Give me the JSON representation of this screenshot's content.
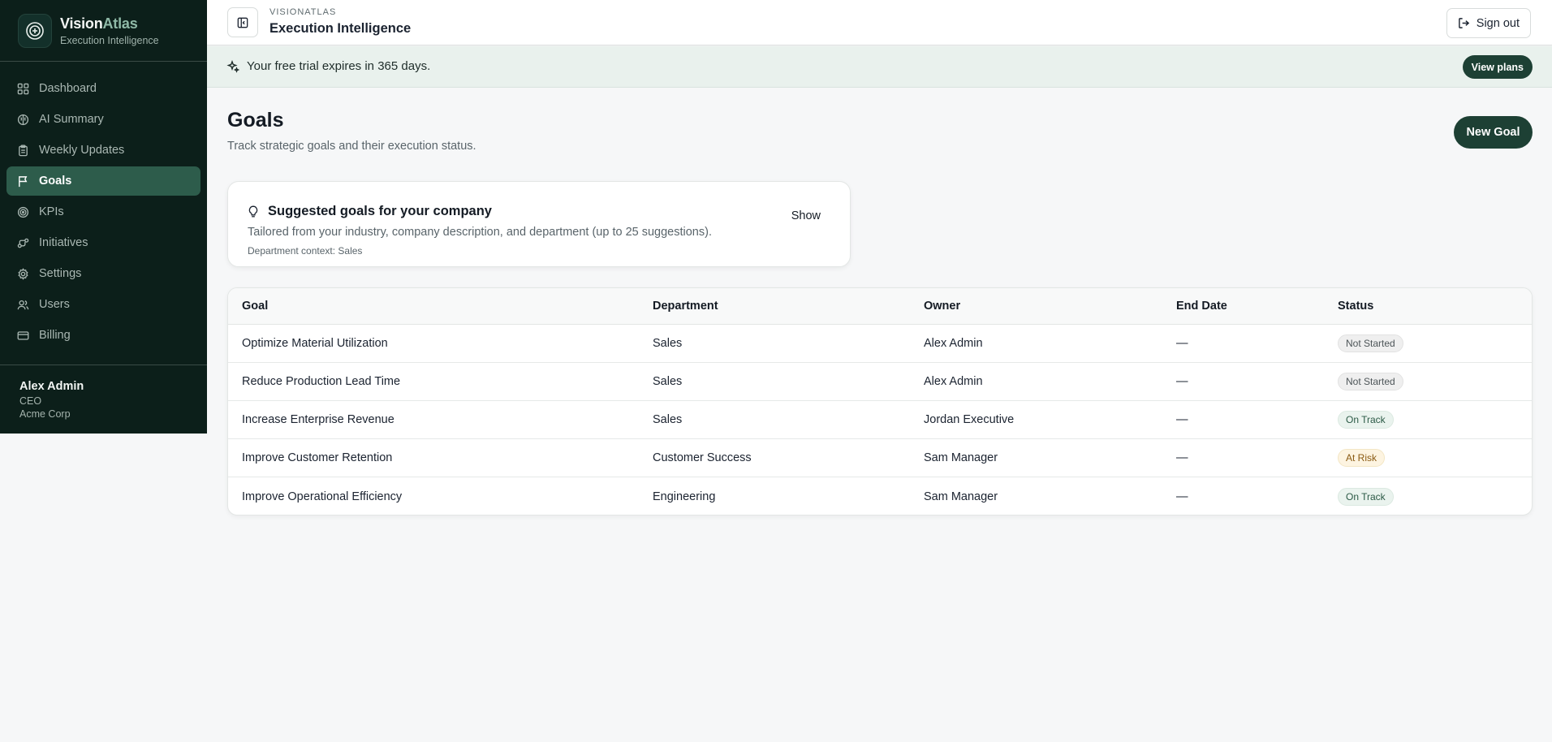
{
  "brand": {
    "name_main": "Vision",
    "name_accent": "Atlas",
    "subtitle": "Execution Intelligence"
  },
  "sidebar": {
    "items": [
      {
        "label": "Dashboard",
        "icon": "grid-icon",
        "active": false
      },
      {
        "label": "AI Summary",
        "icon": "brain-icon",
        "active": false
      },
      {
        "label": "Weekly Updates",
        "icon": "clipboard-icon",
        "active": false
      },
      {
        "label": "Goals",
        "icon": "flag-icon",
        "active": true
      },
      {
        "label": "KPIs",
        "icon": "target-icon",
        "active": false
      },
      {
        "label": "Initiatives",
        "icon": "workflow-icon",
        "active": false
      },
      {
        "label": "Settings",
        "icon": "gear-icon",
        "active": false
      },
      {
        "label": "Users",
        "icon": "users-icon",
        "active": false
      },
      {
        "label": "Billing",
        "icon": "credit-card-icon",
        "active": false
      }
    ],
    "user": {
      "name": "Alex Admin",
      "role": "CEO",
      "company": "Acme Corp"
    }
  },
  "header": {
    "eyebrow": "VISIONATLAS",
    "title": "Execution Intelligence",
    "signout_label": "Sign out"
  },
  "banner": {
    "text": "Your free trial expires in 365 days.",
    "button_label": "View plans"
  },
  "page": {
    "title": "Goals",
    "subtitle": "Track strategic goals and their execution status.",
    "new_goal_label": "New Goal"
  },
  "suggestions": {
    "title": "Suggested goals for your company",
    "description": "Tailored from your industry, company description, and department (up to 25 suggestions).",
    "context": "Department context: Sales",
    "show_label": "Show"
  },
  "table": {
    "columns": [
      "Goal",
      "Department",
      "Owner",
      "End Date",
      "Status"
    ],
    "rows": [
      {
        "goal": "Optimize Material Utilization",
        "department": "Sales",
        "owner": "Alex Admin",
        "end_date": "—",
        "status": "Not Started",
        "status_kind": "not-started"
      },
      {
        "goal": "Reduce Production Lead Time",
        "department": "Sales",
        "owner": "Alex Admin",
        "end_date": "—",
        "status": "Not Started",
        "status_kind": "not-started"
      },
      {
        "goal": "Increase Enterprise Revenue",
        "department": "Sales",
        "owner": "Jordan Executive",
        "end_date": "—",
        "status": "On Track",
        "status_kind": "on-track"
      },
      {
        "goal": "Improve Customer Retention",
        "department": "Customer Success",
        "owner": "Sam Manager",
        "end_date": "—",
        "status": "At Risk",
        "status_kind": "at-risk"
      },
      {
        "goal": "Improve Operational Efficiency",
        "department": "Engineering",
        "owner": "Sam Manager",
        "end_date": "—",
        "status": "On Track",
        "status_kind": "on-track"
      }
    ]
  },
  "colors": {
    "sidebar_bg": "#0c1f1a",
    "accent": "#1d4034",
    "active_nav": "#2d5c4b",
    "banner_bg": "#e9f1ed"
  }
}
